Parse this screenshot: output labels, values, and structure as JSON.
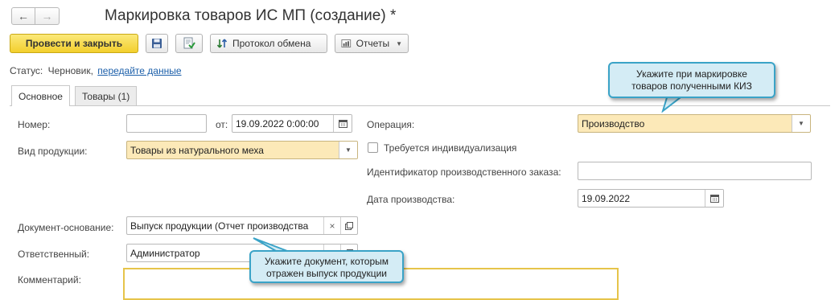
{
  "window": {
    "title": "Маркировка товаров ИС МП (создание) *"
  },
  "nav": {
    "back_icon": "arrow-left-icon",
    "forward_icon": "arrow-right-icon"
  },
  "toolbar": {
    "post_close_label": "Провести и закрыть",
    "exchange_protocol_label": "Протокол обмена",
    "reports_label": "Отчеты"
  },
  "status": {
    "label": "Статус:",
    "value": "Черновик,",
    "link": "передайте данные"
  },
  "tabs": [
    {
      "label": "Основное"
    },
    {
      "label": "Товары (1)"
    }
  ],
  "form": {
    "number": {
      "label": "Номер:",
      "value": ""
    },
    "date": {
      "label": "от:",
      "value": "19.09.2022  0:00:00"
    },
    "product_type": {
      "label": "Вид продукции:",
      "value": "Товары из натурального меха"
    },
    "base_doc": {
      "label": "Документ-основание:",
      "value": "Выпуск продукции (Отчет производства"
    },
    "responsible": {
      "label": "Ответственный:",
      "value": "Администратор"
    },
    "comment": {
      "label": "Комментарий:",
      "value": ""
    },
    "operation": {
      "label": "Операция:",
      "value": "Производство"
    },
    "individualization": {
      "label": "Требуется индивидуализация",
      "checked": false
    },
    "production_order": {
      "label": "Идентификатор производственного заказа:",
      "value": ""
    },
    "production_date": {
      "label": "Дата производства:",
      "value": "19.09.2022"
    }
  },
  "callouts": {
    "kiz": {
      "line1": "Укажите при маркировке",
      "line2": "товаров полученными КИЗ"
    },
    "doc": {
      "line1": "Укажите документ, которым",
      "line2": "отражен выпуск продукции"
    }
  },
  "colors": {
    "primary_button": "#f3cf2d",
    "required_field": "#fce9b8",
    "callout_fill": "#d4ecf5",
    "callout_border": "#3aa3c7",
    "link": "#1a5ea9"
  }
}
